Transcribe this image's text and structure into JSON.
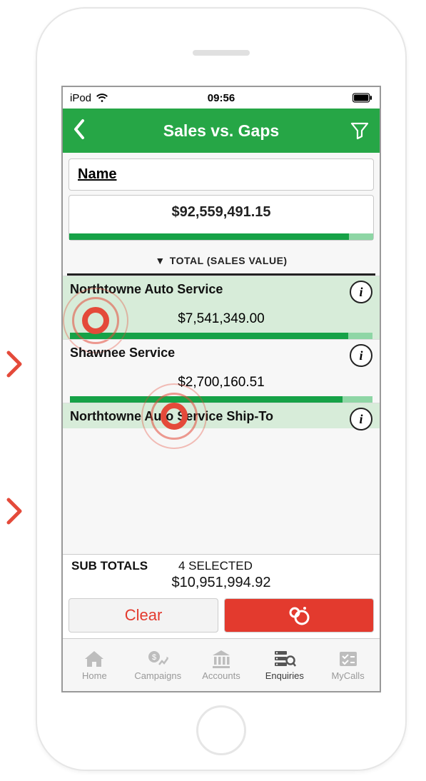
{
  "status": {
    "carrier": "iPod",
    "time": "09:56"
  },
  "nav": {
    "title": "Sales vs. Gaps"
  },
  "name_card": {
    "label": "Name"
  },
  "total": {
    "value": "$92,559,491.15",
    "fill_pct": 92
  },
  "sort": {
    "label": "TOTAL (SALES VALUE)"
  },
  "rows": [
    {
      "name": "Northtowne Auto Service",
      "value": "$7,541,349.00",
      "selected": true,
      "fill_pct": 92
    },
    {
      "name": "Shawnee Service",
      "value": "$2,700,160.51",
      "selected": false,
      "fill_pct": 90
    },
    {
      "name": "Northtowne Auto Service Ship-To",
      "value": "",
      "selected": true,
      "fill_pct": 0
    }
  ],
  "subtotals": {
    "label": "SUB TOTALS",
    "selected": "4 SELECTED",
    "value": "$10,951,994.92"
  },
  "actions": {
    "clear": "Clear"
  },
  "tabs": [
    {
      "id": "home",
      "label": "Home",
      "active": false
    },
    {
      "id": "campaigns",
      "label": "Campaigns",
      "active": false
    },
    {
      "id": "accounts",
      "label": "Accounts",
      "active": false
    },
    {
      "id": "enquiries",
      "label": "Enquiries",
      "active": true
    },
    {
      "id": "mycalls",
      "label": "MyCalls",
      "active": false
    }
  ]
}
